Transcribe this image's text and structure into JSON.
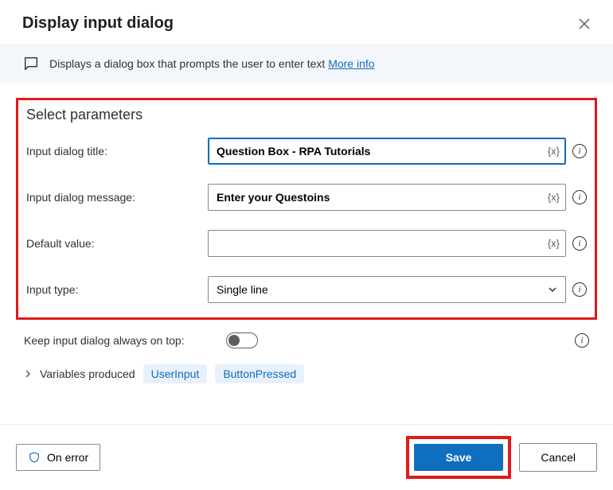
{
  "header": {
    "title": "Display input dialog"
  },
  "banner": {
    "text": "Displays a dialog box that prompts the user to enter text ",
    "link": "More info"
  },
  "section": {
    "heading": "Select parameters"
  },
  "fields": {
    "title_label": "Input dialog title:",
    "title_value": "Question Box - RPA Tutorials",
    "message_label": "Input dialog message:",
    "message_value": "Enter your Questoins",
    "default_label": "Default value:",
    "default_value": "",
    "type_label": "Input type:",
    "type_value": "Single line",
    "keep_top_label": "Keep input dialog always on top:"
  },
  "var_token": "{x}",
  "vars": {
    "label": "Variables produced",
    "items": [
      "UserInput",
      "ButtonPressed"
    ]
  },
  "footer": {
    "onerror": "On error",
    "save": "Save",
    "cancel": "Cancel"
  },
  "info_char": "i"
}
